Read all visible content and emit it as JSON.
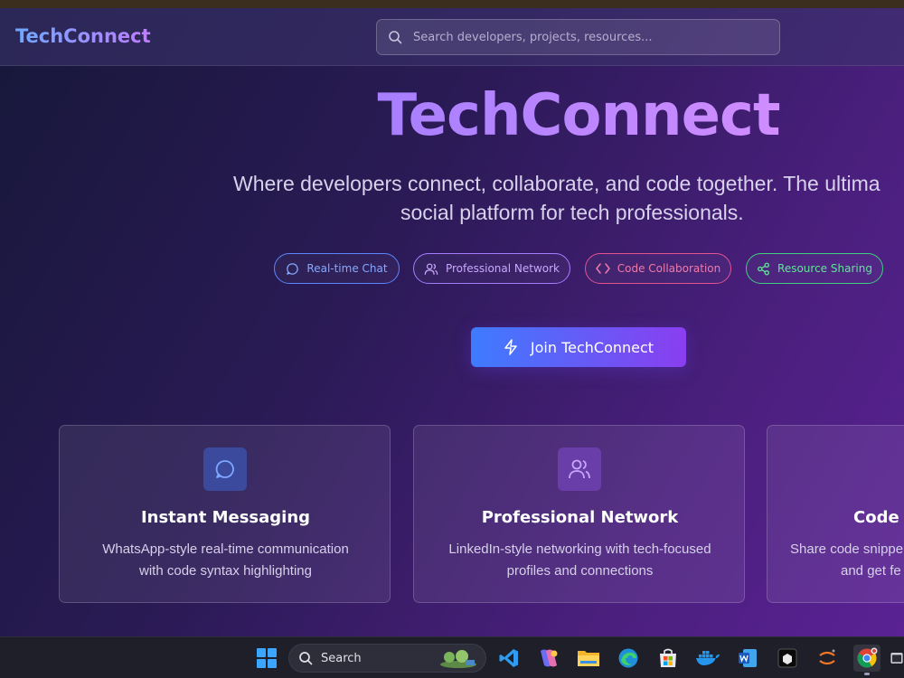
{
  "header": {
    "brand": "TechConnect",
    "search_placeholder": "Search developers, projects, resources..."
  },
  "hero": {
    "title": "TechConnect",
    "subtitle_line1": "Where developers connect, collaborate, and code together. The ultima",
    "subtitle_line2": "social platform for tech professionals."
  },
  "chips": [
    {
      "label": "Real-time Chat",
      "icon": "message-circle-icon",
      "color": "#5b86ff"
    },
    {
      "label": "Professional Network",
      "icon": "users-icon",
      "color": "#a47cff"
    },
    {
      "label": "Code Collaboration",
      "icon": "code-icon",
      "color": "#e2538f"
    },
    {
      "label": "Resource Sharing",
      "icon": "share-icon",
      "color": "#3fcf7e"
    }
  ],
  "cta": {
    "label": "Join TechConnect",
    "icon": "lightning-icon"
  },
  "cards": [
    {
      "title": "Instant Messaging",
      "desc_line1": "WhatsApp-style real-time communication",
      "desc_line2": "with code syntax highlighting",
      "icon": "message-circle-icon"
    },
    {
      "title": "Professional Network",
      "desc_line1": "LinkedIn-style networking with tech-focused",
      "desc_line2": "profiles and connections",
      "icon": "users-icon"
    },
    {
      "title": "Code C",
      "desc_line1": "Share code snippe",
      "desc_line2": "and get fe",
      "icon": "code-icon"
    }
  ],
  "taskbar": {
    "search_label": "Search",
    "apps": [
      "windows-start-icon",
      "vscode-icon",
      "copilot-icon",
      "file-explorer-icon",
      "edge-icon",
      "store-icon",
      "docker-icon",
      "word-icon",
      "terminal-icon",
      "jupyter-icon",
      "chrome-icon",
      "window-icon"
    ]
  }
}
